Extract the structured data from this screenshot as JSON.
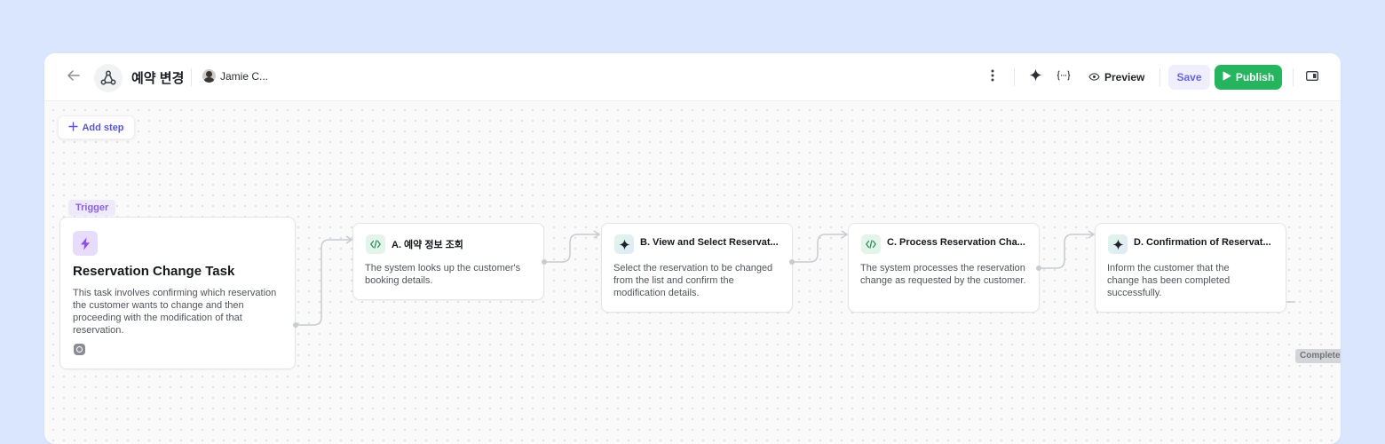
{
  "header": {
    "title": "예약 변경",
    "owner_name": "Jamie C...",
    "preview_label": "Preview",
    "save_label": "Save",
    "publish_label": "Publish"
  },
  "canvas": {
    "add_step_label": "Add step",
    "trigger_tag": "Trigger",
    "trigger_card": {
      "title": "Reservation Change Task",
      "description": "This task involves confirming which reservation the customer wants to change and then proceeding with the modification of that reservation."
    },
    "steps": [
      {
        "icon": "code-icon",
        "title": "A. 예약 정보 조회",
        "description": "The system looks up the customer's booking details."
      },
      {
        "icon": "ai-sparkle-icon",
        "title": "B. View and Select Reservat...",
        "description": "Select the reservation to be changed from the list and confirm the modification details."
      },
      {
        "icon": "code-icon",
        "title": "C. Process Reservation Cha...",
        "description": "The system processes the reservation change as requested by the customer."
      },
      {
        "icon": "ai-sparkle-icon",
        "title": "D. Confirmation of Reservat...",
        "description": "Inform the customer that the change has been completed successfully."
      }
    ],
    "complete_tag": "Complete"
  },
  "colors": {
    "background": "#d9e6fd",
    "publish": "#26b55f",
    "save_text": "#6b62e3",
    "trigger_accent": "#8a62d9",
    "add_step_text": "#5a55d6"
  }
}
